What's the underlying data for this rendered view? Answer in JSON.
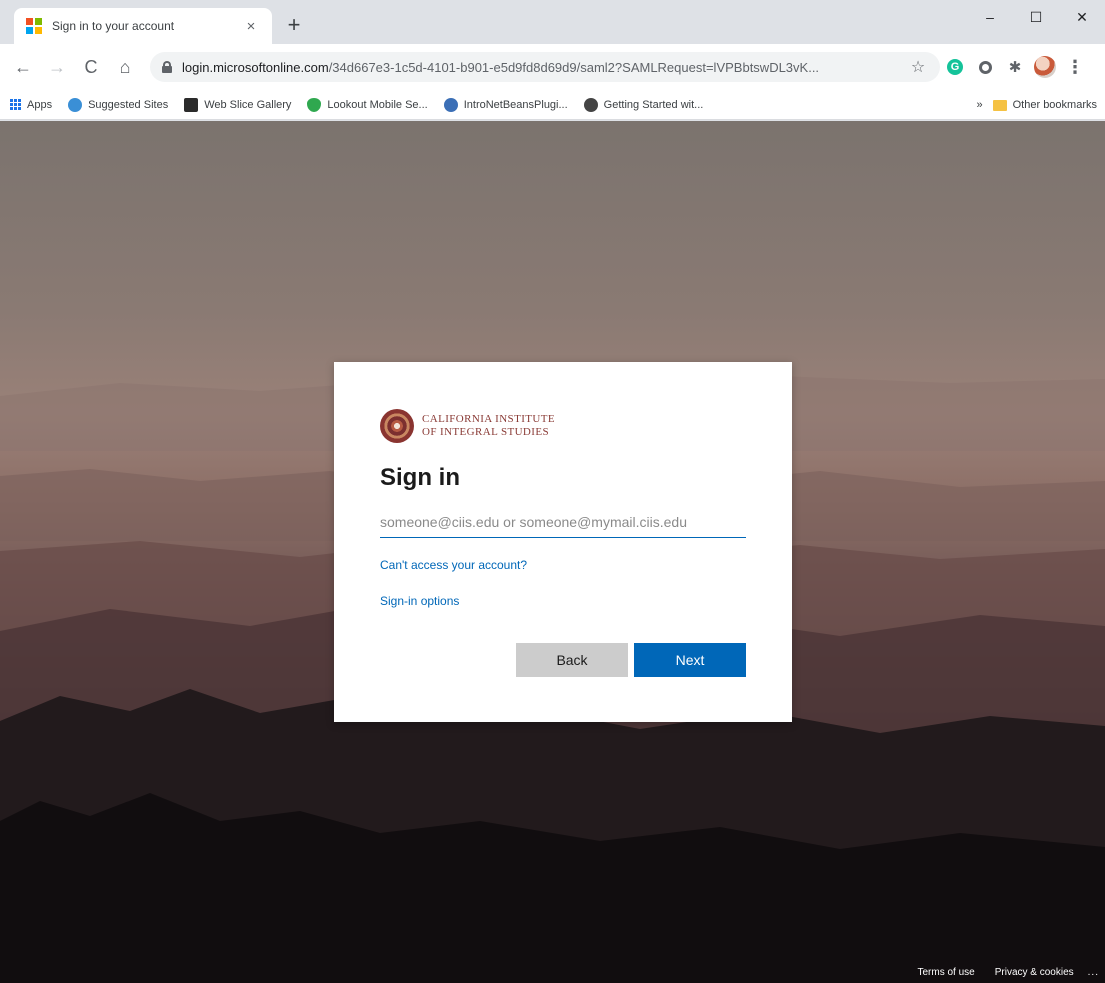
{
  "browser": {
    "tab": {
      "title": "Sign in to your account",
      "close": "×",
      "new_tab": "+"
    },
    "window": {
      "minimize": "–",
      "maximize": "☐",
      "close": "✕"
    },
    "nav": {
      "back": "←",
      "forward": "→",
      "reload": "C",
      "home": "⌂"
    },
    "url": {
      "host": "login.microsoftonline.com",
      "path": "/34d667e3-1c5d-4101-b901-e5d9fd8d69d9/saml2?SAMLRequest=lVPBbtswDL3vK..."
    },
    "star": "☆",
    "extensions": {
      "grammarly": "G",
      "puzzle": "✱",
      "menu": "⋮"
    },
    "bookmarks": [
      {
        "label": "Apps",
        "icon": "apps-grid-icon",
        "color": "#1a73e8"
      },
      {
        "label": "Suggested Sites",
        "icon": "ie-icon",
        "color": "#3a8fd6"
      },
      {
        "label": "Web Slice Gallery",
        "icon": "web-slice-icon",
        "color": "#2b2b2b"
      },
      {
        "label": "Lookout Mobile Se...",
        "icon": "lookout-shield-icon",
        "color": "#2fa84f"
      },
      {
        "label": "IntroNetBeansPlugi...",
        "icon": "netbeans-icon",
        "color": "#3b6fb6"
      },
      {
        "label": "Getting Started wit...",
        "icon": "globe-icon",
        "color": "#444444"
      }
    ],
    "bookmarks_overflow": "»",
    "other_bookmarks": "Other bookmarks"
  },
  "signin": {
    "org_line1": "California Institute",
    "org_line2": "of Integral Studies",
    "title": "Sign in",
    "email_placeholder": "someone@ciis.edu or someone@mymail.ciis.edu",
    "email_value": "",
    "cant_access": "Can't access your account?",
    "signin_options": "Sign-in options",
    "back": "Back",
    "next": "Next"
  },
  "footer": {
    "terms": "Terms of use",
    "privacy": "Privacy & cookies",
    "more": "..."
  },
  "colors": {
    "accent": "#0067b8",
    "org_text": "#8a3b36",
    "back_button": "#cccccc"
  }
}
